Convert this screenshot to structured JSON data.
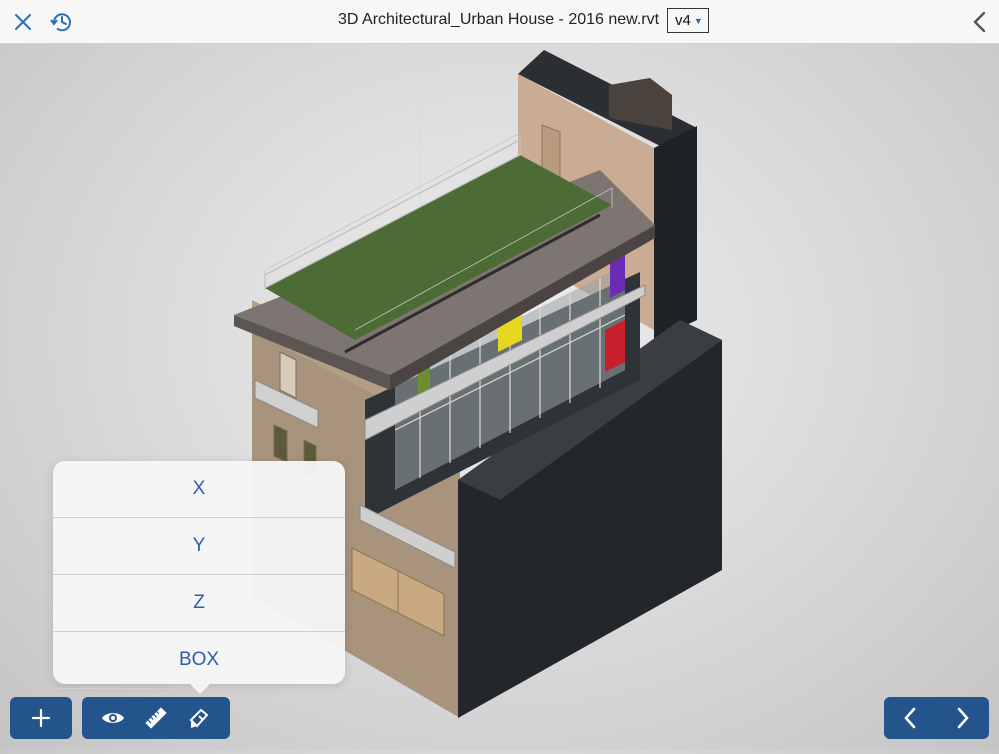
{
  "header": {
    "title": "3D Architectural_Urban House - 2016 new.rvt",
    "version": "v4",
    "close_icon": "close-icon",
    "history_icon": "history-icon",
    "back_icon": "chevron-left-icon"
  },
  "section_popover": {
    "items": [
      {
        "label": "X"
      },
      {
        "label": "Y"
      },
      {
        "label": "Z"
      },
      {
        "label": "BOX"
      }
    ]
  },
  "toolbar": {
    "add_icon": "plus-icon",
    "tools": [
      "eye-icon",
      "ruler-icon",
      "section-icon"
    ],
    "nav": [
      "chevron-left-icon",
      "chevron-right-icon"
    ]
  },
  "colors": {
    "accent": "#23548c",
    "link": "#2d5fa3",
    "roof_green": "#4d6b34",
    "wall_tan": "#c7ad95",
    "wall_dark": "#23272b"
  }
}
